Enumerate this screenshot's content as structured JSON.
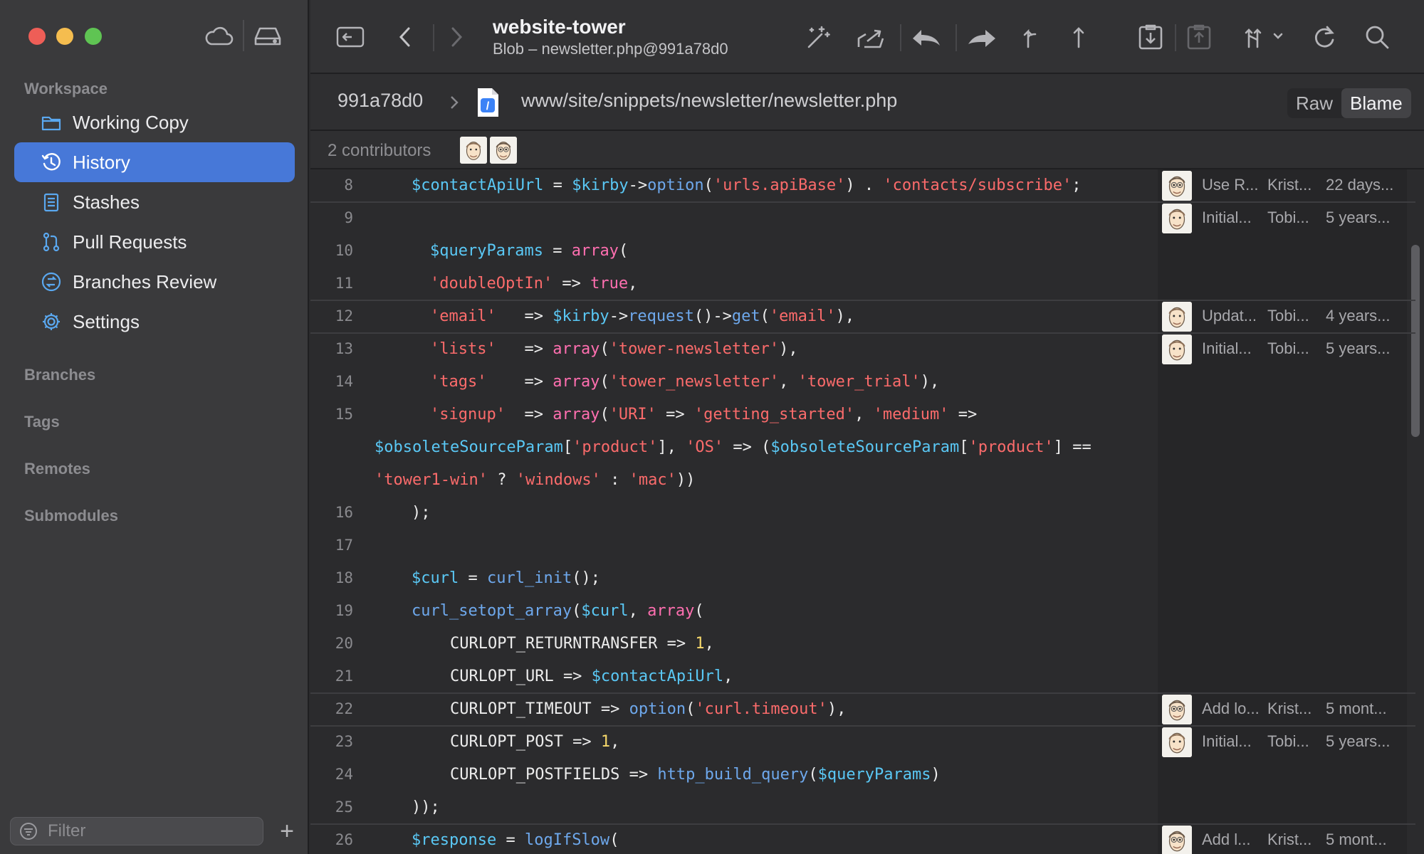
{
  "window": {
    "title": "website-tower",
    "subtitle": "Blob – newsletter.php@991a78d0"
  },
  "sidebar": {
    "workspace_label": "Workspace",
    "items": [
      {
        "label": "Working Copy",
        "icon": "folder-icon"
      },
      {
        "label": "History",
        "icon": "history-icon",
        "active": true
      },
      {
        "label": "Stashes",
        "icon": "stash-icon"
      },
      {
        "label": "Pull Requests",
        "icon": "pull-request-icon"
      },
      {
        "label": "Branches Review",
        "icon": "branches-review-icon"
      },
      {
        "label": "Settings",
        "icon": "gear-icon"
      }
    ],
    "sections": [
      "Branches",
      "Tags",
      "Remotes",
      "Submodules"
    ],
    "filter_placeholder": "Filter",
    "add_label": "+"
  },
  "pathbar": {
    "commit": "991a78d0",
    "file_path": "www/site/snippets/newsletter/newsletter.php",
    "view_modes": [
      "Raw",
      "Blame"
    ],
    "active_view": "Blame"
  },
  "contributors": {
    "label": "2 contributors"
  },
  "code_lines": [
    {
      "line": "8",
      "tokens": [
        [
          "v",
          "$contactApiUrl"
        ],
        [
          "p",
          " = "
        ],
        [
          "v",
          "$kirby"
        ],
        [
          "p",
          "->"
        ],
        [
          "f",
          "option"
        ],
        [
          "p",
          "("
        ],
        [
          "s",
          "'urls.apiBase'"
        ],
        [
          "p",
          ") . "
        ],
        [
          "s",
          "'contacts/subscribe'"
        ],
        [
          "p",
          ";"
        ]
      ]
    },
    {
      "line": "9",
      "tokens": []
    },
    {
      "line": "10",
      "tokens": [
        [
          "v",
          "$queryParams"
        ],
        [
          "p",
          " = "
        ],
        [
          "k",
          "array"
        ],
        [
          "p",
          "("
        ]
      ]
    },
    {
      "line": "11",
      "tokens": [
        [
          "s",
          "'doubleOptIn'"
        ],
        [
          "p",
          " => "
        ],
        [
          "k",
          "true"
        ],
        [
          "p",
          ","
        ]
      ]
    },
    {
      "line": "12",
      "tokens": [
        [
          "s",
          "'email'"
        ],
        [
          "p",
          "   => "
        ],
        [
          "v",
          "$kirby"
        ],
        [
          "p",
          "->"
        ],
        [
          "f",
          "request"
        ],
        [
          "p",
          "()->"
        ],
        [
          "f",
          "get"
        ],
        [
          "p",
          "("
        ],
        [
          "s",
          "'email'"
        ],
        [
          "p",
          "),"
        ]
      ]
    },
    {
      "line": "13",
      "tokens": [
        [
          "s",
          "'lists'"
        ],
        [
          "p",
          "   => "
        ],
        [
          "k",
          "array"
        ],
        [
          "p",
          "("
        ],
        [
          "s",
          "'tower-newsletter'"
        ],
        [
          "p",
          "),"
        ]
      ]
    },
    {
      "line": "14",
      "tokens": [
        [
          "s",
          "'tags'"
        ],
        [
          "p",
          "    => "
        ],
        [
          "k",
          "array"
        ],
        [
          "p",
          "("
        ],
        [
          "s",
          "'tower_newsletter'"
        ],
        [
          "p",
          ", "
        ],
        [
          "s",
          "'tower_trial'"
        ],
        [
          "p",
          "),"
        ]
      ]
    },
    {
      "line": "15",
      "tokens": [
        [
          "s",
          "'signup'"
        ],
        [
          "p",
          "  => "
        ],
        [
          "k",
          "array"
        ],
        [
          "p",
          "("
        ],
        [
          "s",
          "'URI'"
        ],
        [
          "p",
          " => "
        ],
        [
          "s",
          "'getting_started'"
        ],
        [
          "p",
          ", "
        ],
        [
          "s",
          "'medium'"
        ],
        [
          "p",
          " =>"
        ]
      ]
    },
    {
      "line": "",
      "tokens": [
        [
          "v",
          "$obsoleteSourceParam"
        ],
        [
          "p",
          "["
        ],
        [
          "s",
          "'product'"
        ],
        [
          "p",
          "], "
        ],
        [
          "s",
          "'OS'"
        ],
        [
          "p",
          " => ("
        ],
        [
          "v",
          "$obsoleteSourceParam"
        ],
        [
          "p",
          "["
        ],
        [
          "s",
          "'product'"
        ],
        [
          "p",
          "] =="
        ]
      ]
    },
    {
      "line": "",
      "tokens": [
        [
          "s",
          "'tower1-win'"
        ],
        [
          "p",
          " ? "
        ],
        [
          "s",
          "'windows'"
        ],
        [
          "p",
          " : "
        ],
        [
          "s",
          "'mac'"
        ],
        [
          "p",
          "))"
        ]
      ]
    },
    {
      "line": "16",
      "tokens": [
        [
          "p",
          ");"
        ]
      ]
    },
    {
      "line": "17",
      "tokens": []
    },
    {
      "line": "18",
      "tokens": [
        [
          "v",
          "$curl"
        ],
        [
          "p",
          " = "
        ],
        [
          "f",
          "curl_init"
        ],
        [
          "p",
          "();"
        ]
      ]
    },
    {
      "line": "19",
      "tokens": [
        [
          "f",
          "curl_setopt_array"
        ],
        [
          "p",
          "("
        ],
        [
          "v",
          "$curl"
        ],
        [
          "p",
          ", "
        ],
        [
          "k",
          "array"
        ],
        [
          "p",
          "("
        ]
      ]
    },
    {
      "line": "20",
      "tokens": [
        [
          "p",
          "CURLOPT_RETURNTRANSFER => "
        ],
        [
          "n",
          "1"
        ],
        [
          "p",
          ","
        ]
      ]
    },
    {
      "line": "21",
      "tokens": [
        [
          "p",
          "CURLOPT_URL => "
        ],
        [
          "v",
          "$contactApiUrl"
        ],
        [
          "p",
          ","
        ]
      ]
    },
    {
      "line": "22",
      "tokens": [
        [
          "p",
          "CURLOPT_TIMEOUT => "
        ],
        [
          "f",
          "option"
        ],
        [
          "p",
          "("
        ],
        [
          "s",
          "'curl.timeout'"
        ],
        [
          "p",
          "),"
        ]
      ]
    },
    {
      "line": "23",
      "tokens": [
        [
          "p",
          "CURLOPT_POST => "
        ],
        [
          "n",
          "1"
        ],
        [
          "p",
          ","
        ]
      ]
    },
    {
      "line": "24",
      "tokens": [
        [
          "p",
          "CURLOPT_POSTFIELDS => "
        ],
        [
          "f",
          "http_build_query"
        ],
        [
          "p",
          "("
        ],
        [
          "v",
          "$queryParams"
        ],
        [
          "p",
          ")"
        ]
      ]
    },
    {
      "line": "25",
      "tokens": [
        [
          "p",
          "));"
        ]
      ]
    },
    {
      "line": "26",
      "tokens": [
        [
          "v",
          "$response"
        ],
        [
          "p",
          " = "
        ],
        [
          "f",
          "logIfSlow"
        ],
        [
          "p",
          "("
        ]
      ]
    }
  ],
  "blame": [
    {
      "message": "Use R...",
      "author": "Krist...",
      "date": "22 days..."
    },
    {
      "message": "Initial...",
      "author": "Tobi...",
      "date": "5 years..."
    },
    {
      "message": "Updat...",
      "author": "Tobi...",
      "date": "4 years..."
    },
    {
      "message": "Initial...",
      "author": "Tobi...",
      "date": "5 years..."
    },
    {
      "message": "Add lo...",
      "author": "Krist...",
      "date": "5 mont..."
    },
    {
      "message": "Initial...",
      "author": "Tobi...",
      "date": "5 years..."
    },
    {
      "message": "Add l...",
      "author": "Krist...",
      "date": "5 mont..."
    }
  ],
  "colors": {
    "accent": "#4778d8",
    "variable": "#5ac8f5",
    "string": "#fb6b6b",
    "keyword": "#ff6fb0",
    "function": "#6ea8ec",
    "number": "#f6d86b"
  }
}
